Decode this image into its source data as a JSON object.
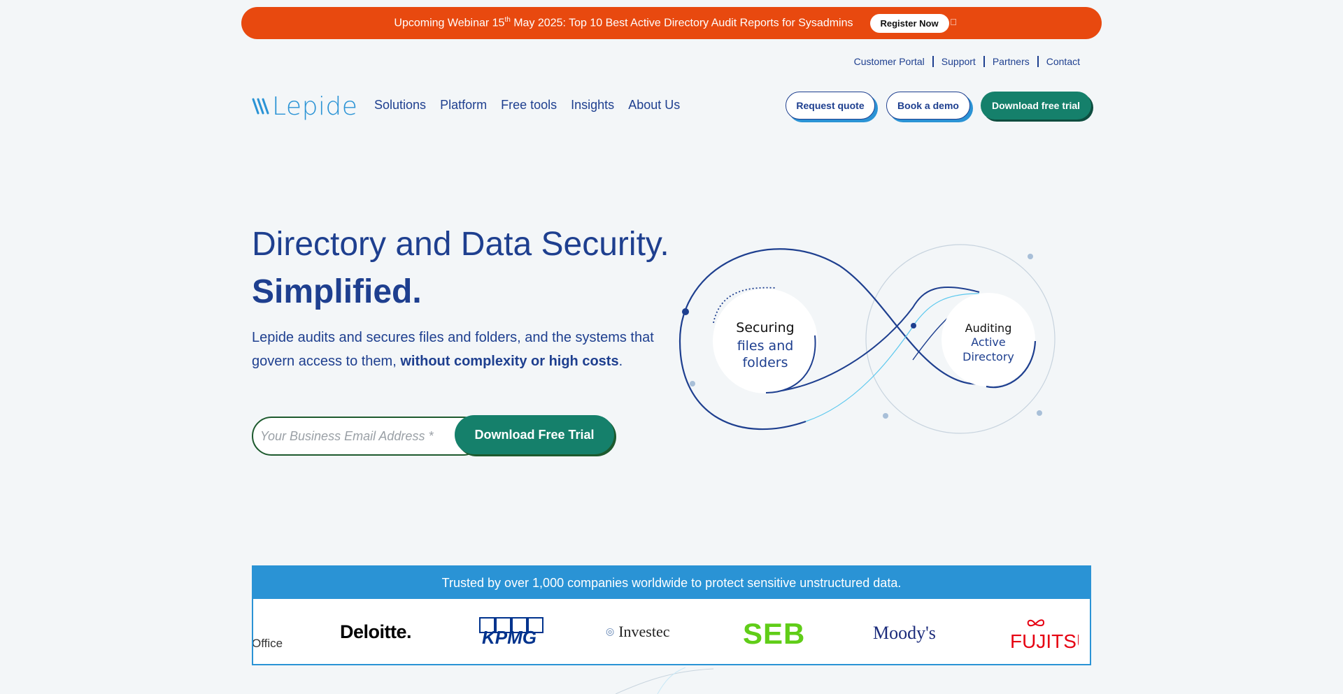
{
  "announcement": {
    "text_before": "Upcoming Webinar 15",
    "text_sup": "th",
    "text_after": " May 2025: Top 10 Best Active Directory Audit Reports for Sysadmins",
    "cta": "Register Now",
    "close_icon": "close-icon",
    "color": "#e8490f"
  },
  "utility_links": [
    "Customer Portal",
    "Support",
    "Partners",
    "Contact"
  ],
  "header": {
    "logo_text": "Lepide",
    "nav": [
      "Solutions",
      "Platform",
      "Free tools",
      "Insights",
      "About Us"
    ],
    "buttons": {
      "request_quote": "Request quote",
      "book_demo": "Book a demo",
      "download_trial": "Download free trial"
    }
  },
  "hero": {
    "title_line1": "Directory and Data Security.",
    "title_line2": "Simplified.",
    "desc_plain": "Lepide audits and secures files and folders, and the systems that govern access to them, ",
    "desc_bold": "without complexity or high costs",
    "desc_end": ".",
    "email_placeholder": "Your Business Email Address *",
    "submit_label": "Download Free Trial",
    "diagram": {
      "left_circle": [
        "Securing",
        "files and",
        "folders"
      ],
      "right_circle": [
        "Auditing",
        "Active",
        "Directory"
      ]
    }
  },
  "trusted": {
    "banner": "Trusted by over 1,000 companies worldwide to protect sensitive unstructured data.",
    "logos": [
      "Office",
      "Deloitte.",
      "KPMG",
      "Investec",
      "SEB",
      "Moody's",
      "FUJITSU"
    ]
  },
  "colors": {
    "primary": "#1e3f8f",
    "accent": "#2a93d5",
    "green": "#15806b",
    "background": "#f3f6f8"
  }
}
